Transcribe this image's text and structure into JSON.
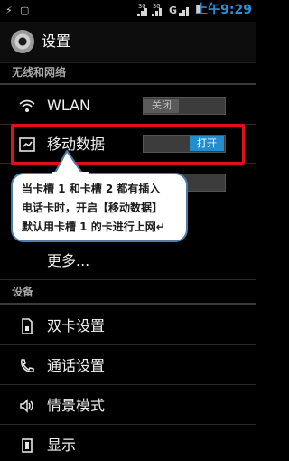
{
  "status_bar": {
    "net_a": "3G",
    "net_b": "3G",
    "time": "上午9:29"
  },
  "app_bar": {
    "title": "设置"
  },
  "sections": {
    "wireless": "无线和网络",
    "device": "设备"
  },
  "wireless_items": {
    "wlan": {
      "label": "WLAN",
      "toggle": "关闭"
    },
    "mobile_data": {
      "label": "移动数据",
      "toggle": "打开"
    },
    "more": {
      "label": "更多..."
    }
  },
  "device_items": {
    "dual_sim": "双卡设置",
    "call": "通话设置",
    "scene": "情景模式",
    "display": "显示"
  },
  "callout": {
    "line1": "当卡槽 1 和卡槽 2 都有插入",
    "line2": "电话卡时，开启【移动数据】",
    "line3": "默认用卡槽 1 的卡进行上网↵"
  },
  "colors": {
    "accent": "#1f8fd0",
    "highlight": "#e0101b",
    "clock": "#2d8fd6"
  }
}
